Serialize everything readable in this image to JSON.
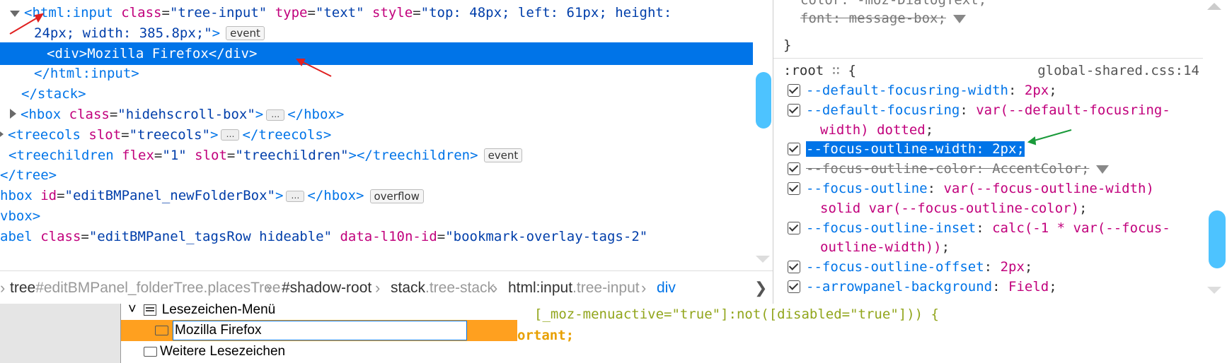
{
  "markup": {
    "lines": [
      {
        "indent": 30,
        "twisty": "open",
        "tag_open": "<html:input",
        "attrs": [
          [
            "class",
            "\"tree-input\""
          ],
          [
            "type",
            "\"text\""
          ],
          [
            "style",
            "\"top: 48px; left: 61px; height:"
          ]
        ]
      },
      {
        "indent": 48,
        "cont": "24px; width: 385.8px;\"",
        "close": ">",
        "badge": "event"
      },
      {
        "indent": 66,
        "selected": true,
        "text": "<div>Mozilla Firefox</div>"
      },
      {
        "indent": 48,
        "text": "</html:input>"
      },
      {
        "indent": 30,
        "text": "</stack>"
      },
      {
        "indent": 30,
        "twisty": "closed",
        "pre": "<hbox ",
        "a": "class",
        "v": "\"hidehscroll-box\"",
        "post": ">",
        "ellipsis": true,
        "end": "</hbox>"
      },
      {
        "indent": 12,
        "twisty": "closed",
        "pre": "<treecols ",
        "a": "slot",
        "v": "\"treecols\"",
        "post": ">",
        "ellipsis": true,
        "end": "</treecols>"
      },
      {
        "indent": 12,
        "pre": "<treechildren ",
        "a": "flex",
        "v": "\"1\"",
        "a2": "slot",
        "v2": "\"treechildren\"",
        "post": "></treechildren>",
        "badge": "event"
      },
      {
        "indent": 0,
        "text": "</tree>"
      },
      {
        "indent": 0,
        "pre": "hbox ",
        "a": "id",
        "v": "\"editBMPanel_newFolderBox\"",
        "post": ">",
        "ellipsis": true,
        "end": "</hbox>",
        "badge": "overflow"
      },
      {
        "indent": 0,
        "text": "vbox>"
      },
      {
        "indent": 0,
        "pre": "abel ",
        "a": "class",
        "v": "\"editBMPanel_tagsRow hideable\"",
        "a2": "data-l10n-id",
        "v2": "\"bookmark-overlay-tags-2\""
      }
    ]
  },
  "breadcrumb": {
    "items": [
      {
        "name": "tree",
        "cls": "#editBMPanel_folderTree.placesTree"
      },
      {
        "name": "#shadow-root",
        "cls": ""
      },
      {
        "name": "stack",
        "cls": ".tree-stack"
      },
      {
        "name": "html:input",
        "cls": ".tree-input"
      },
      {
        "name": "div",
        "cls": "",
        "active": true
      }
    ]
  },
  "rules": {
    "top_partial": [
      {
        "prop": "color",
        "val": "-moz-DialogText",
        "strike": true
      },
      {
        "prop": "font",
        "val": "message-box",
        "strike": true
      }
    ],
    "close_brace": "}",
    "selector": ":root",
    "source": "global-shared.css:14",
    "declarations": [
      {
        "prop": "--default-focusring-width",
        "val": "2px"
      },
      {
        "prop": "--default-focusring",
        "val": "var(--default-focusring-",
        "val2": "width) dotted"
      },
      {
        "prop": "--focus-outline-width",
        "val": "2px",
        "highlight": true
      },
      {
        "prop": "--focus-outline-color",
        "val": "AccentColor",
        "strike": true
      },
      {
        "prop": "--focus-outline",
        "val": "var(--focus-outline-width)",
        "val2": "solid var(--focus-outline-color)"
      },
      {
        "prop": "--focus-outline-inset",
        "val": "calc(-1 * var(--focus-",
        "val2": "outline-width))"
      },
      {
        "prop": "--focus-outline-offset",
        "val": "2px"
      },
      {
        "prop": "--arrowpanel-background",
        "val": "Field"
      }
    ]
  },
  "bookmarks_tree": {
    "items": [
      {
        "label": "Lesezeichen-Menü"
      },
      {
        "label": "Mozilla Firefox",
        "selected": true
      },
      {
        "label": "Weitere Lesezeichen"
      }
    ]
  },
  "css_bottom": {
    "line1": "[_moz-menuactive=\"true\"]:not([disabled=\"true\"])) {",
    "line2": "ortant;"
  },
  "colors": {
    "selection": "#0074e8",
    "tag": "#0074e8",
    "attr": "#c1007c",
    "value": "#003eaa",
    "tree_selected": "#ffa01f",
    "css_selector_green": "#91a51b",
    "css_important_orange": "#e8a000",
    "annotation_red": "#e02020",
    "annotation_green": "#1a9a3a"
  }
}
